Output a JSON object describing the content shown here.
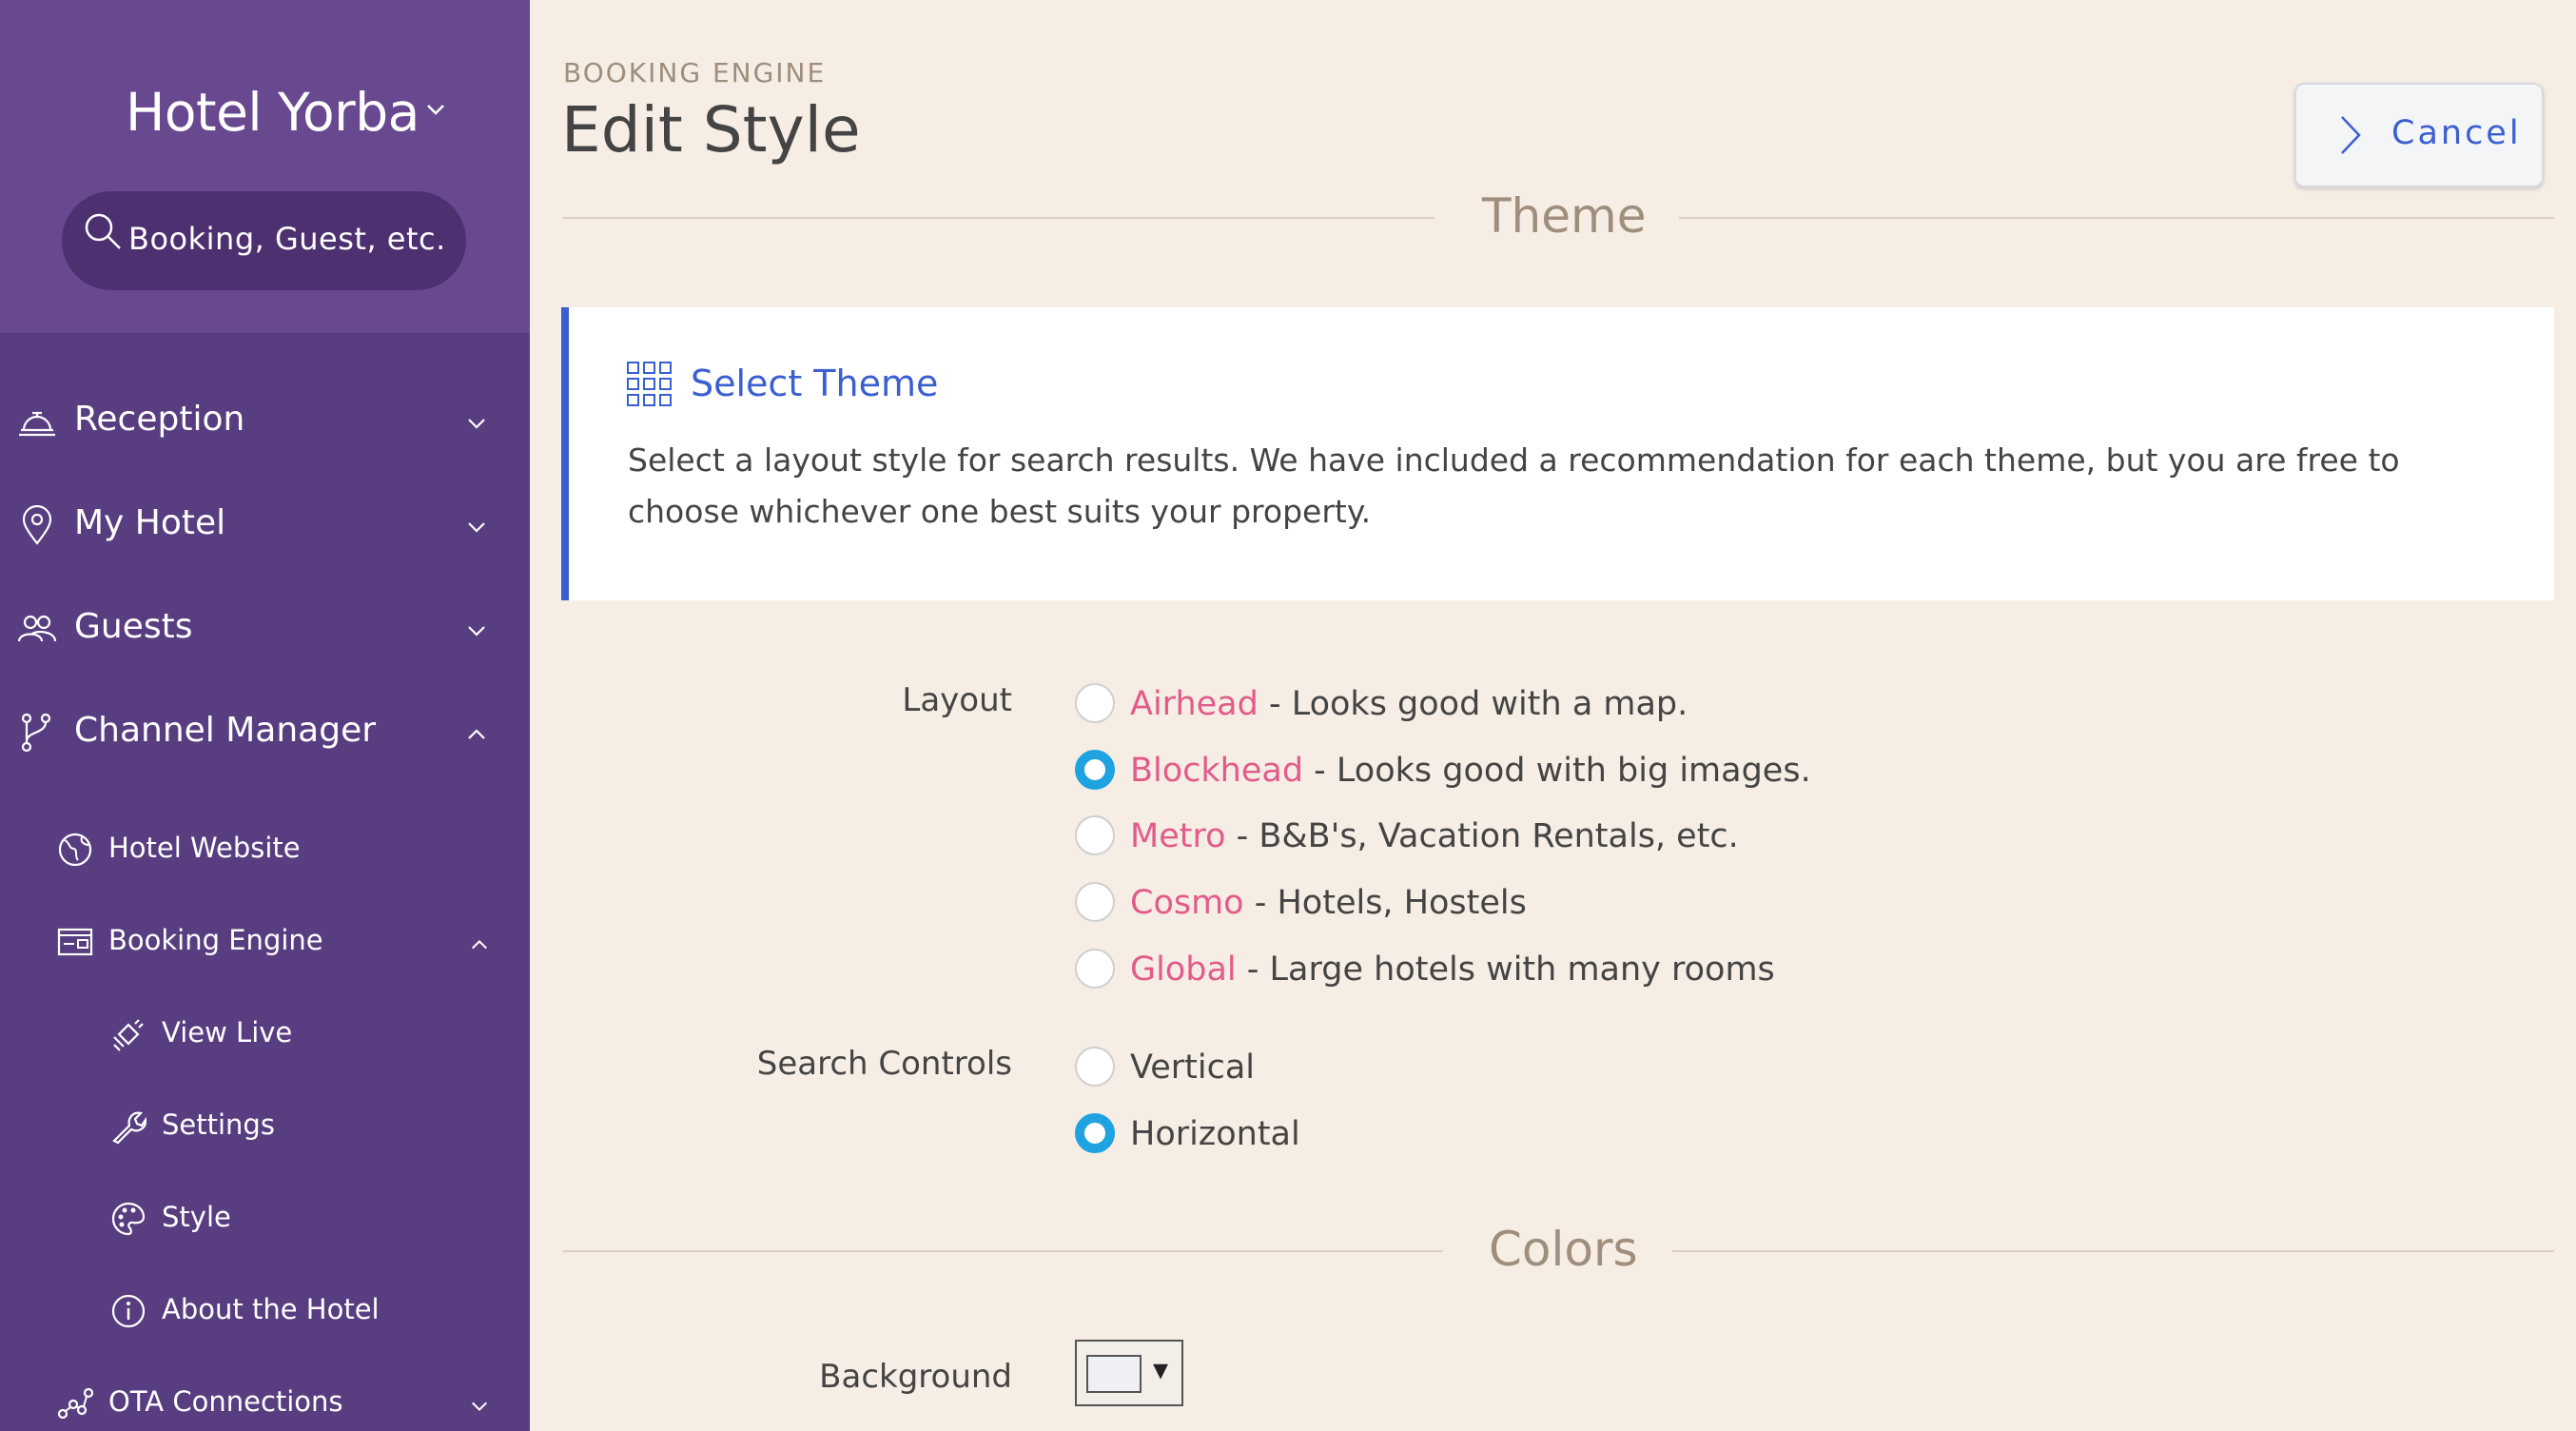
{
  "sidebar": {
    "hotel_name": "Hotel Yorba",
    "search_placeholder": "Booking, Guest, etc.",
    "items": [
      {
        "label": "Reception"
      },
      {
        "label": "My Hotel"
      },
      {
        "label": "Guests"
      },
      {
        "label": "Channel Manager"
      },
      {
        "label": "Hotel Website"
      },
      {
        "label": "Booking Engine"
      },
      {
        "label": "View Live"
      },
      {
        "label": "Settings"
      },
      {
        "label": "Style"
      },
      {
        "label": "About the Hotel"
      },
      {
        "label": "OTA Connections"
      }
    ]
  },
  "header": {
    "breadcrumb": "BOOKING ENGINE",
    "title": "Edit Style",
    "cancel_label": "Cancel"
  },
  "theme_section": {
    "heading": "Theme",
    "card_title": "Select Theme",
    "card_desc": "Select a layout style for search results. We have included a recommendation for each theme, but you are free to choose whichever one best suits your property.",
    "layout_label": "Layout",
    "layout_options": [
      {
        "name": "Airhead",
        "desc": " - Looks good with a map.",
        "checked": false
      },
      {
        "name": "Blockhead",
        "desc": " - Looks good with big images.",
        "checked": true
      },
      {
        "name": "Metro",
        "desc": " - B&B's, Vacation Rentals, etc.",
        "checked": false
      },
      {
        "name": "Cosmo",
        "desc": " - Hotels, Hostels",
        "checked": false
      },
      {
        "name": "Global",
        "desc": " - Large hotels with many rooms",
        "checked": false
      }
    ],
    "search_controls_label": "Search Controls",
    "search_controls_options": [
      {
        "name": "Vertical",
        "checked": false
      },
      {
        "name": "Horizontal",
        "checked": true
      }
    ]
  },
  "colors_section": {
    "heading": "Colors",
    "background_label": "Background",
    "background_swatch": "#eef0f4"
  },
  "colors": {
    "sidebar": "#583e80",
    "sidebar_top": "#68498f",
    "accent": "#3a5fd0",
    "theme_name": "#e25b8a",
    "radio_checked": "#1fa3e0",
    "page_bg": "#f6ede5"
  }
}
